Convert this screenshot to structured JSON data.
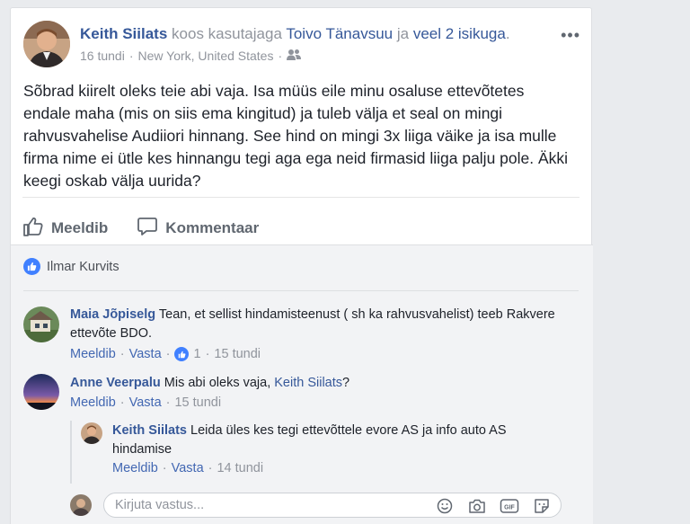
{
  "post": {
    "author": "Keith Siilats",
    "with_text": "koos kasutajaga",
    "tagged": "Toivo Tänavsuu",
    "and_text": "ja",
    "others": "veel 2 isikuga",
    "dot": ".",
    "time": "16 tundi",
    "sep": "·",
    "location": "New York, United States",
    "privacy_icon": "friends-icon",
    "more_icon": "more-options-icon",
    "text": "Sõbrad kiirelt oleks teie abi vaja. Isa müüs eile minu osaluse ettevõtetes endale maha (mis on siis ema kingitud) ja tuleb välja et seal on mingi rahvusvahelise Audiiori hinnang. See hind on mingi 3x liiga väike ja isa mulle firma nime ei ütle kes hinnangu tegi aga ega neid firmasid liiga palju pole. Äkki keegi oskab välja uurida?"
  },
  "actions": {
    "like": "Meeldib",
    "comment": "Kommentaar"
  },
  "likers": "Ilmar Kurvits",
  "comments": [
    {
      "name": "Maia Jõpiselg",
      "text": "Tean, et sellist hindamisteenust ( sh ka rahvusvahelist) teeb Rakvere ettevõte BDO.",
      "like": "Meeldib",
      "reply": "Vasta",
      "likes": "1",
      "time": "15 tundi"
    },
    {
      "name": "Anne Veerpalu",
      "text": "Mis abi oleks vaja,",
      "mention": "Keith Siilats",
      "end": "?",
      "like": "Meeldib",
      "reply": "Vasta",
      "time": "15 tundi"
    }
  ],
  "reply": {
    "name": "Keith Siilats",
    "text": "Leida üles kes tegi ettevõttele evore AS ja info auto AS hindamise",
    "like": "Meeldib",
    "reply": "Vasta",
    "time": "14 tundi"
  },
  "reply_input": {
    "placeholder": "Kirjuta vastus..."
  },
  "colors": {
    "link": "#365899",
    "like_blue": "#4080ff",
    "muted": "#90949c"
  }
}
